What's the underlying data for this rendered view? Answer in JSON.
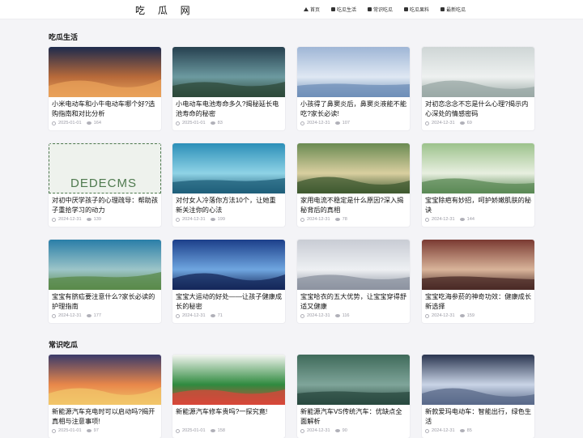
{
  "header": {
    "logo": "吃 瓜 网",
    "nav": [
      {
        "label": "首页",
        "icon": "home-icon"
      },
      {
        "label": "吃瓜生活",
        "icon": "book-icon"
      },
      {
        "label": "常识吃瓜",
        "icon": "book-icon"
      },
      {
        "label": "吃瓜果料",
        "icon": "book-icon"
      },
      {
        "label": "最新吃瓜",
        "icon": "book-icon"
      }
    ]
  },
  "sections": [
    {
      "title": "吃瓜生活",
      "cards": [
        {
          "title": "小米电动车和小牛电动车哪个好?选购指南和对比分析",
          "date": "2025-01-01",
          "views": "164"
        },
        {
          "title": "小电动车电池寿命多久?揭秘延长电池寿命的秘密",
          "date": "2025-01-01",
          "views": "83"
        },
        {
          "title": "小孩得了鼻窦炎后，鼻窦炎液能不能吃?家长必读!",
          "date": "2024-12-31",
          "views": "107"
        },
        {
          "title": "对初恋念念不忘是什么心理?揭示内心深处的情感密码",
          "date": "2024-12-31",
          "views": "69"
        },
        {
          "title": "对初中厌学孩子的心理疏导：帮助孩子重拾学习的动力",
          "date": "2024-12-31",
          "views": "139",
          "placeholder": "DEDECMS"
        },
        {
          "title": "对付女人冷落你方法10个，让她重新关注你的心法",
          "date": "2024-12-31",
          "views": "199"
        },
        {
          "title": "家用电流不稳定是什么原因?深入揭秘背后的真相",
          "date": "2024-12-31",
          "views": "78"
        },
        {
          "title": "宝宝除疤有妙招，呵护娇嫩肌肤的秘诀",
          "date": "2024-12-31",
          "views": "144"
        },
        {
          "title": "宝宝有脐疝要注意什么?家长必读的护理指南",
          "date": "2024-12-31",
          "views": "177"
        },
        {
          "title": "宝宝大运动的好处——让孩子健康成长的秘密",
          "date": "2024-12-31",
          "views": "71"
        },
        {
          "title": "宝宝哈衣的五大优势，让宝宝穿得舒适又健康",
          "date": "2024-12-31",
          "views": "116"
        },
        {
          "title": "宝宝吃海参菸的神奇功效：健康成长新选择",
          "date": "2024-12-31",
          "views": "159"
        }
      ]
    },
    {
      "title": "常识吃瓜",
      "cards": [
        {
          "title": "新能源汽车充电时可以启动吗?揭开真相与注意事项!",
          "date": "2025-01-01",
          "views": "97"
        },
        {
          "title": "新能源汽车修车贵吗?一探究竟!",
          "date": "2025-01-01",
          "views": "158"
        },
        {
          "title": "新能源汽车VS传统汽车：优缺点全面解析",
          "date": "2024-12-31",
          "views": "90"
        },
        {
          "title": "新款爱玛电动车：智能出行，绿色生活",
          "date": "2024-12-31",
          "views": "85"
        }
      ]
    }
  ]
}
